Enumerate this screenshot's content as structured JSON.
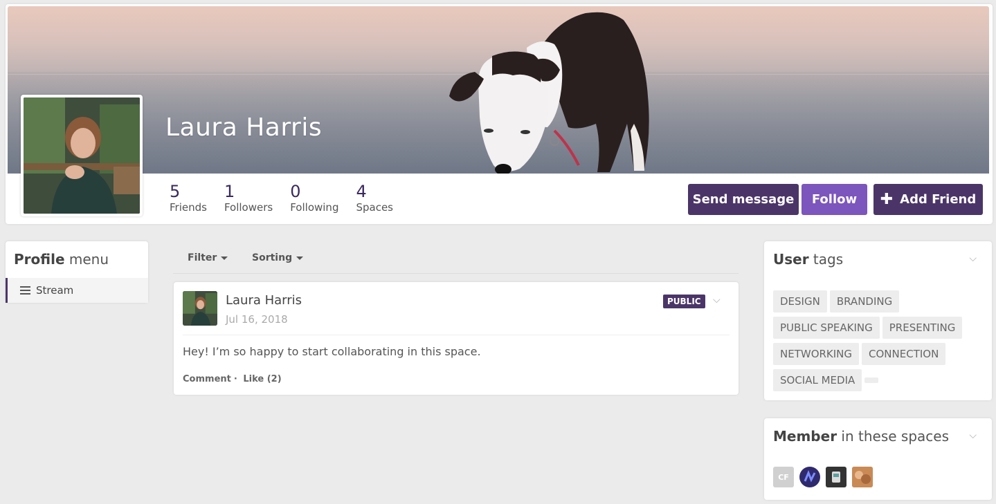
{
  "profile": {
    "name": "Laura Harris",
    "stats": [
      {
        "value": "5",
        "label": "Friends"
      },
      {
        "value": "1",
        "label": "Followers"
      },
      {
        "value": "0",
        "label": "Following"
      },
      {
        "value": "4",
        "label": "Spaces"
      }
    ],
    "buttons": {
      "send_message": "Send message",
      "follow": "Follow",
      "add_friend": "Add Friend"
    }
  },
  "profile_menu": {
    "title_bold": "Profile",
    "title_rest": " menu",
    "items": [
      {
        "label": "Stream",
        "icon": "hamburger-icon"
      }
    ]
  },
  "stream": {
    "filter_label": "Filter",
    "sorting_label": "Sorting",
    "post": {
      "author": "Laura Harris",
      "date": "Jul 16, 2018",
      "visibility": "PUBLIC",
      "text": "Hey! I’m so happy to start collaborating in this space.",
      "comment_label": "Comment",
      "like_label": "Like (2)"
    }
  },
  "user_tags": {
    "title_bold": "User",
    "title_rest": " tags",
    "tags": [
      "DESIGN",
      "BRANDING",
      "PUBLIC SPEAKING",
      "PRESENTING",
      "NETWORKING",
      "CONNECTION",
      "SOCIAL MEDIA"
    ]
  },
  "member_spaces": {
    "title_bold": "Member",
    "title_rest": " in these spaces",
    "spaces": [
      {
        "label": "CF"
      },
      {
        "label": ""
      },
      {
        "label": ""
      },
      {
        "label": ""
      }
    ]
  },
  "colors": {
    "primary": "#4b3568",
    "follow": "#7c55bd",
    "background": "#ebebeb"
  }
}
